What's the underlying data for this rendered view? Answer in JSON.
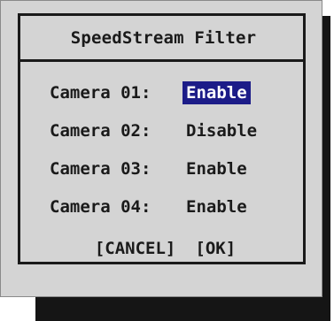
{
  "dialog": {
    "title": "SpeedStream Filter",
    "cameras": [
      {
        "label": "Camera 01:",
        "value": "Enable",
        "selected": true
      },
      {
        "label": "Camera 02:",
        "value": "Disable",
        "selected": false
      },
      {
        "label": "Camera 03:",
        "value": "Enable",
        "selected": false
      },
      {
        "label": "Camera 04:",
        "value": "Enable",
        "selected": false
      }
    ],
    "buttons": {
      "cancel_label": "[CANCEL]",
      "ok_label": "[OK]"
    }
  },
  "colors": {
    "background": "#d4d4d4",
    "selection": "#1c1c88",
    "text": "#1a1a1a",
    "shadow": "#151515"
  }
}
